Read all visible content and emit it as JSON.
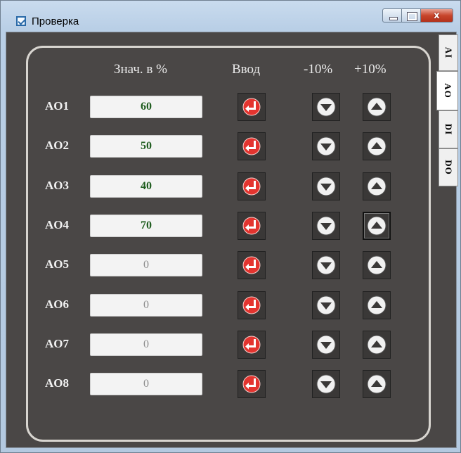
{
  "window": {
    "title": "Проверка",
    "close_glyph": "x"
  },
  "tabs": [
    {
      "label": "AI",
      "active": false
    },
    {
      "label": "AO",
      "active": true
    },
    {
      "label": "DI",
      "active": false
    },
    {
      "label": "DO",
      "active": false
    }
  ],
  "headers": {
    "value": "Знач. в %",
    "enter": "Ввод",
    "minus": "-10%",
    "plus": "+10%"
  },
  "rows": [
    {
      "label": "AO1",
      "value": "60",
      "set": true
    },
    {
      "label": "AO2",
      "value": "50",
      "set": true
    },
    {
      "label": "AO3",
      "value": "40",
      "set": true
    },
    {
      "label": "AO4",
      "value": "70",
      "set": true
    },
    {
      "label": "AO5",
      "value": "0",
      "set": false
    },
    {
      "label": "AO6",
      "value": "0",
      "set": false
    },
    {
      "label": "AO7",
      "value": "0",
      "set": false
    },
    {
      "label": "AO8",
      "value": "0",
      "set": false
    }
  ],
  "icons": {
    "enter": "enter-arrow-icon",
    "minus": "triangle-down-icon",
    "plus": "triangle-up-icon"
  },
  "colors": {
    "background": "#4a4746",
    "value_set": "#1e5c1e",
    "value_zero": "#8b8b8b",
    "enter_icon": "#e3342f"
  }
}
